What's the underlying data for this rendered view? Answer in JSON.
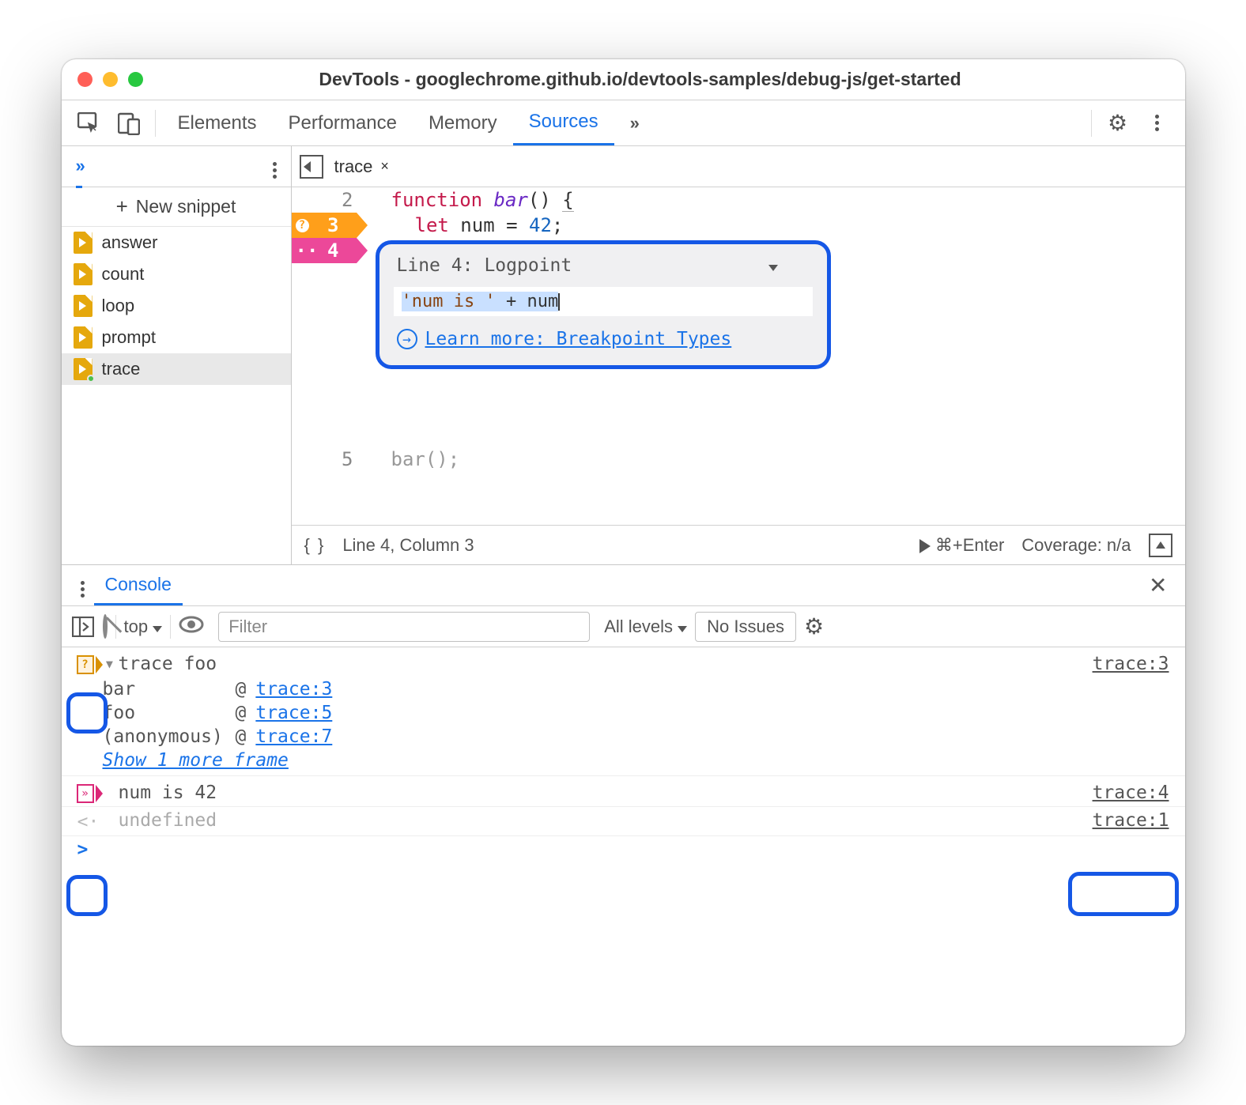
{
  "window": {
    "title": "DevTools - googlechrome.github.io/devtools-samples/debug-js/get-started"
  },
  "tabs": {
    "items": [
      "Elements",
      "Performance",
      "Memory",
      "Sources"
    ],
    "overflow": "»",
    "active": "Sources"
  },
  "sidebar": {
    "overflow": "»",
    "new_snippet": "New snippet",
    "files": [
      {
        "name": "answer"
      },
      {
        "name": "count"
      },
      {
        "name": "loop"
      },
      {
        "name": "prompt"
      },
      {
        "name": "trace",
        "selected": true,
        "modified": true
      }
    ]
  },
  "editor": {
    "tab": {
      "name": "trace",
      "close": "×"
    },
    "lines": {
      "l2": {
        "num": "2"
      },
      "l3": {
        "num": "3",
        "marker": "?"
      },
      "l4": {
        "num": "4",
        "marker": "··"
      },
      "l5": {
        "num": "5",
        "code": "bar();"
      }
    },
    "code": {
      "l2_kw": "function",
      "l2_fn": " bar",
      "l2_rest": "() ",
      "l2_brace": "{",
      "l3_kw": "let",
      "l3_mid": " num = ",
      "l3_num": "42",
      "l3_end": ";",
      "l4": "}"
    },
    "popup": {
      "line_label": "Line 4:",
      "type": "Logpoint",
      "input_str": "'num is '",
      "input_rest": " + num",
      "link": "Learn more: Breakpoint Types"
    },
    "status": {
      "braces": "{ }",
      "cursor": "Line 4, Column 3",
      "run": "▶",
      "shortcut": "⌘+Enter",
      "coverage": "Coverage: n/a"
    }
  },
  "console": {
    "tab": "Console",
    "toolbar": {
      "context": "top",
      "filter_placeholder": "Filter",
      "levels": "All levels",
      "issues": "No Issues"
    },
    "entries": [
      {
        "type": "trace",
        "text": "trace foo",
        "source": "trace:3",
        "stack": [
          {
            "fn": "bar",
            "src": "trace:3"
          },
          {
            "fn": "foo",
            "src": "trace:5"
          },
          {
            "fn": "(anonymous)",
            "src": "trace:7"
          }
        ],
        "more": "Show 1 more frame"
      },
      {
        "type": "logpoint",
        "text": "num is 42",
        "source": "trace:4"
      },
      {
        "type": "return",
        "text": "undefined",
        "source": "trace:1"
      }
    ],
    "prompt": ">"
  }
}
